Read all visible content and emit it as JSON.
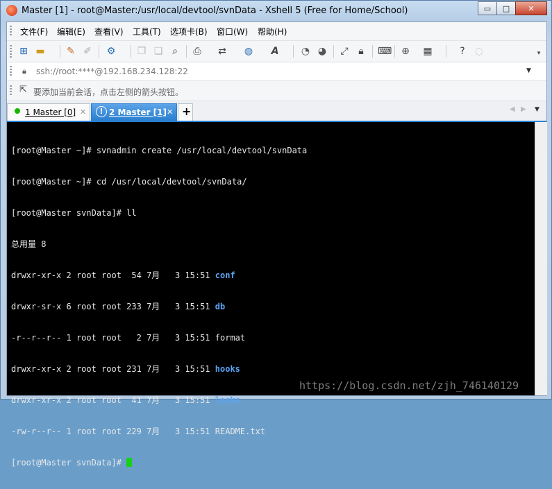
{
  "window": {
    "title": "Master [1] - root@Master:/usr/local/devtool/svnData - Xshell 5 (Free for Home/School)",
    "buttons": {
      "minimize": "▭",
      "maximize": "□",
      "close": "✕"
    }
  },
  "menubar": {
    "items": [
      "文件(F)",
      "编辑(E)",
      "查看(V)",
      "工具(T)",
      "选项卡(B)",
      "窗口(W)",
      "帮助(H)"
    ]
  },
  "toolbar": {
    "icons": [
      "new-session-icon",
      "open-folder-icon",
      "connect-icon",
      "disconnect-icon",
      "properties-icon",
      "copy-icon",
      "paste-icon",
      "find-icon",
      "print-icon",
      "transfer-icon",
      "globe-icon",
      "font-icon",
      "xftp-icon",
      "xmanager-icon",
      "fullscreen-icon",
      "lock-icon",
      "keyboard-icon",
      "add-tab-icon",
      "layout-icon",
      "help-icon",
      "chat-icon"
    ]
  },
  "address_bar": {
    "value": "ssh://root:****@192.168.234.128:22"
  },
  "hint_bar": {
    "text": "要添加当前会话，点击左侧的箭头按钮。"
  },
  "tabs": [
    {
      "label": "1 Master [0]",
      "active": false,
      "status_color": "#19b300"
    },
    {
      "label": "2 Master [1]",
      "active": true
    }
  ],
  "terminal": {
    "lines": [
      {
        "text": "[root@Master ~]# svnadmin create /usr/local/devtool/svnData"
      },
      {
        "text": "[root@Master ~]# cd /usr/local/devtool/svnData/"
      },
      {
        "text": "[root@Master svnData]# ll"
      },
      {
        "text": "总用量 8"
      },
      {
        "prefix": "drwxr-xr-x 2 root root  54 7月   3 15:51 ",
        "name": "conf",
        "is_dir": true
      },
      {
        "prefix": "drwxr-sr-x 6 root root 233 7月   3 15:51 ",
        "name": "db",
        "is_dir": true
      },
      {
        "prefix": "-r--r--r-- 1 root root   2 7月   3 15:51 ",
        "name": "format",
        "is_dir": false
      },
      {
        "prefix": "drwxr-xr-x 2 root root 231 7月   3 15:51 ",
        "name": "hooks",
        "is_dir": true
      },
      {
        "prefix": "drwxr-xr-x 2 root root  41 7月   3 15:51 ",
        "name": "locks",
        "is_dir": true
      },
      {
        "prefix": "-rw-r--r-- 1 root root 229 7月   3 15:51 ",
        "name": "README.txt",
        "is_dir": false
      }
    ],
    "prompt": "[root@Master svnData]# ",
    "dir_color": "#5aa5f5",
    "cursor_color": "#18d018"
  },
  "watermark": "https://blog.csdn.net/zjh_746140129"
}
